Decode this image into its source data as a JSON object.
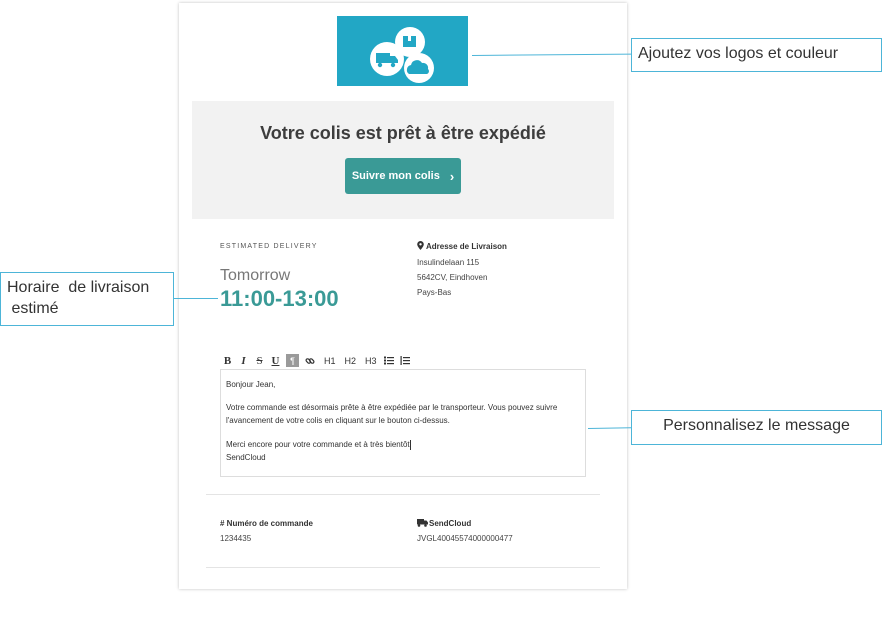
{
  "email": {
    "hero_title": "Votre colis est prêt à être expédié",
    "track_button": "Suivre mon colis",
    "track_chevron": "›",
    "estimated_label": "ESTIMATED DELIVERY",
    "estimated_day": "Tomorrow",
    "estimated_time": "11:00-13:00",
    "address": {
      "icon": "map-pin-icon",
      "title": "Adresse de Livraison",
      "lines": [
        "Insulindelaan 115",
        "5642CV, Eindhoven",
        "Pays-Bas"
      ]
    },
    "toolbar": {
      "bold": "B",
      "italic": "I",
      "strike": "S",
      "underline": "U",
      "paragraph": "¶",
      "link_icon": "link-icon",
      "h1": "H1",
      "h2": "H2",
      "h3": "H3",
      "bullet_icon": "bullet-list-icon",
      "numbered_icon": "numbered-list-icon"
    },
    "message": {
      "greeting": "Bonjour Jean,",
      "body": "Votre commande  est désormais prête à être expédiée par  le transporteur. Vous pouvez suivre l'avancement de votre colis en cliquant sur le bouton ci-dessus.",
      "closing": "Merci encore pour votre commande et à très bientôt",
      "signature": "SendCloud"
    },
    "order": {
      "label": "# Numéro de commande",
      "value": "1234435"
    },
    "carrier": {
      "icon": "truck-icon",
      "label": "SendCloud",
      "value": "JVGL40045574000000477"
    },
    "logo_icons": [
      "truck-icon",
      "package-icon",
      "cloud-icon"
    ]
  },
  "callouts": {
    "logo": "Ajoutez vos logos et couleur",
    "delivery_line1": "Horaire  de livraison",
    "delivery_line2": " estimé",
    "message": "Personnalisez le message"
  },
  "colors": {
    "brand_blue": "#22a7c5",
    "accent_teal": "#3a9a96",
    "callout_border": "#4db5d8"
  }
}
